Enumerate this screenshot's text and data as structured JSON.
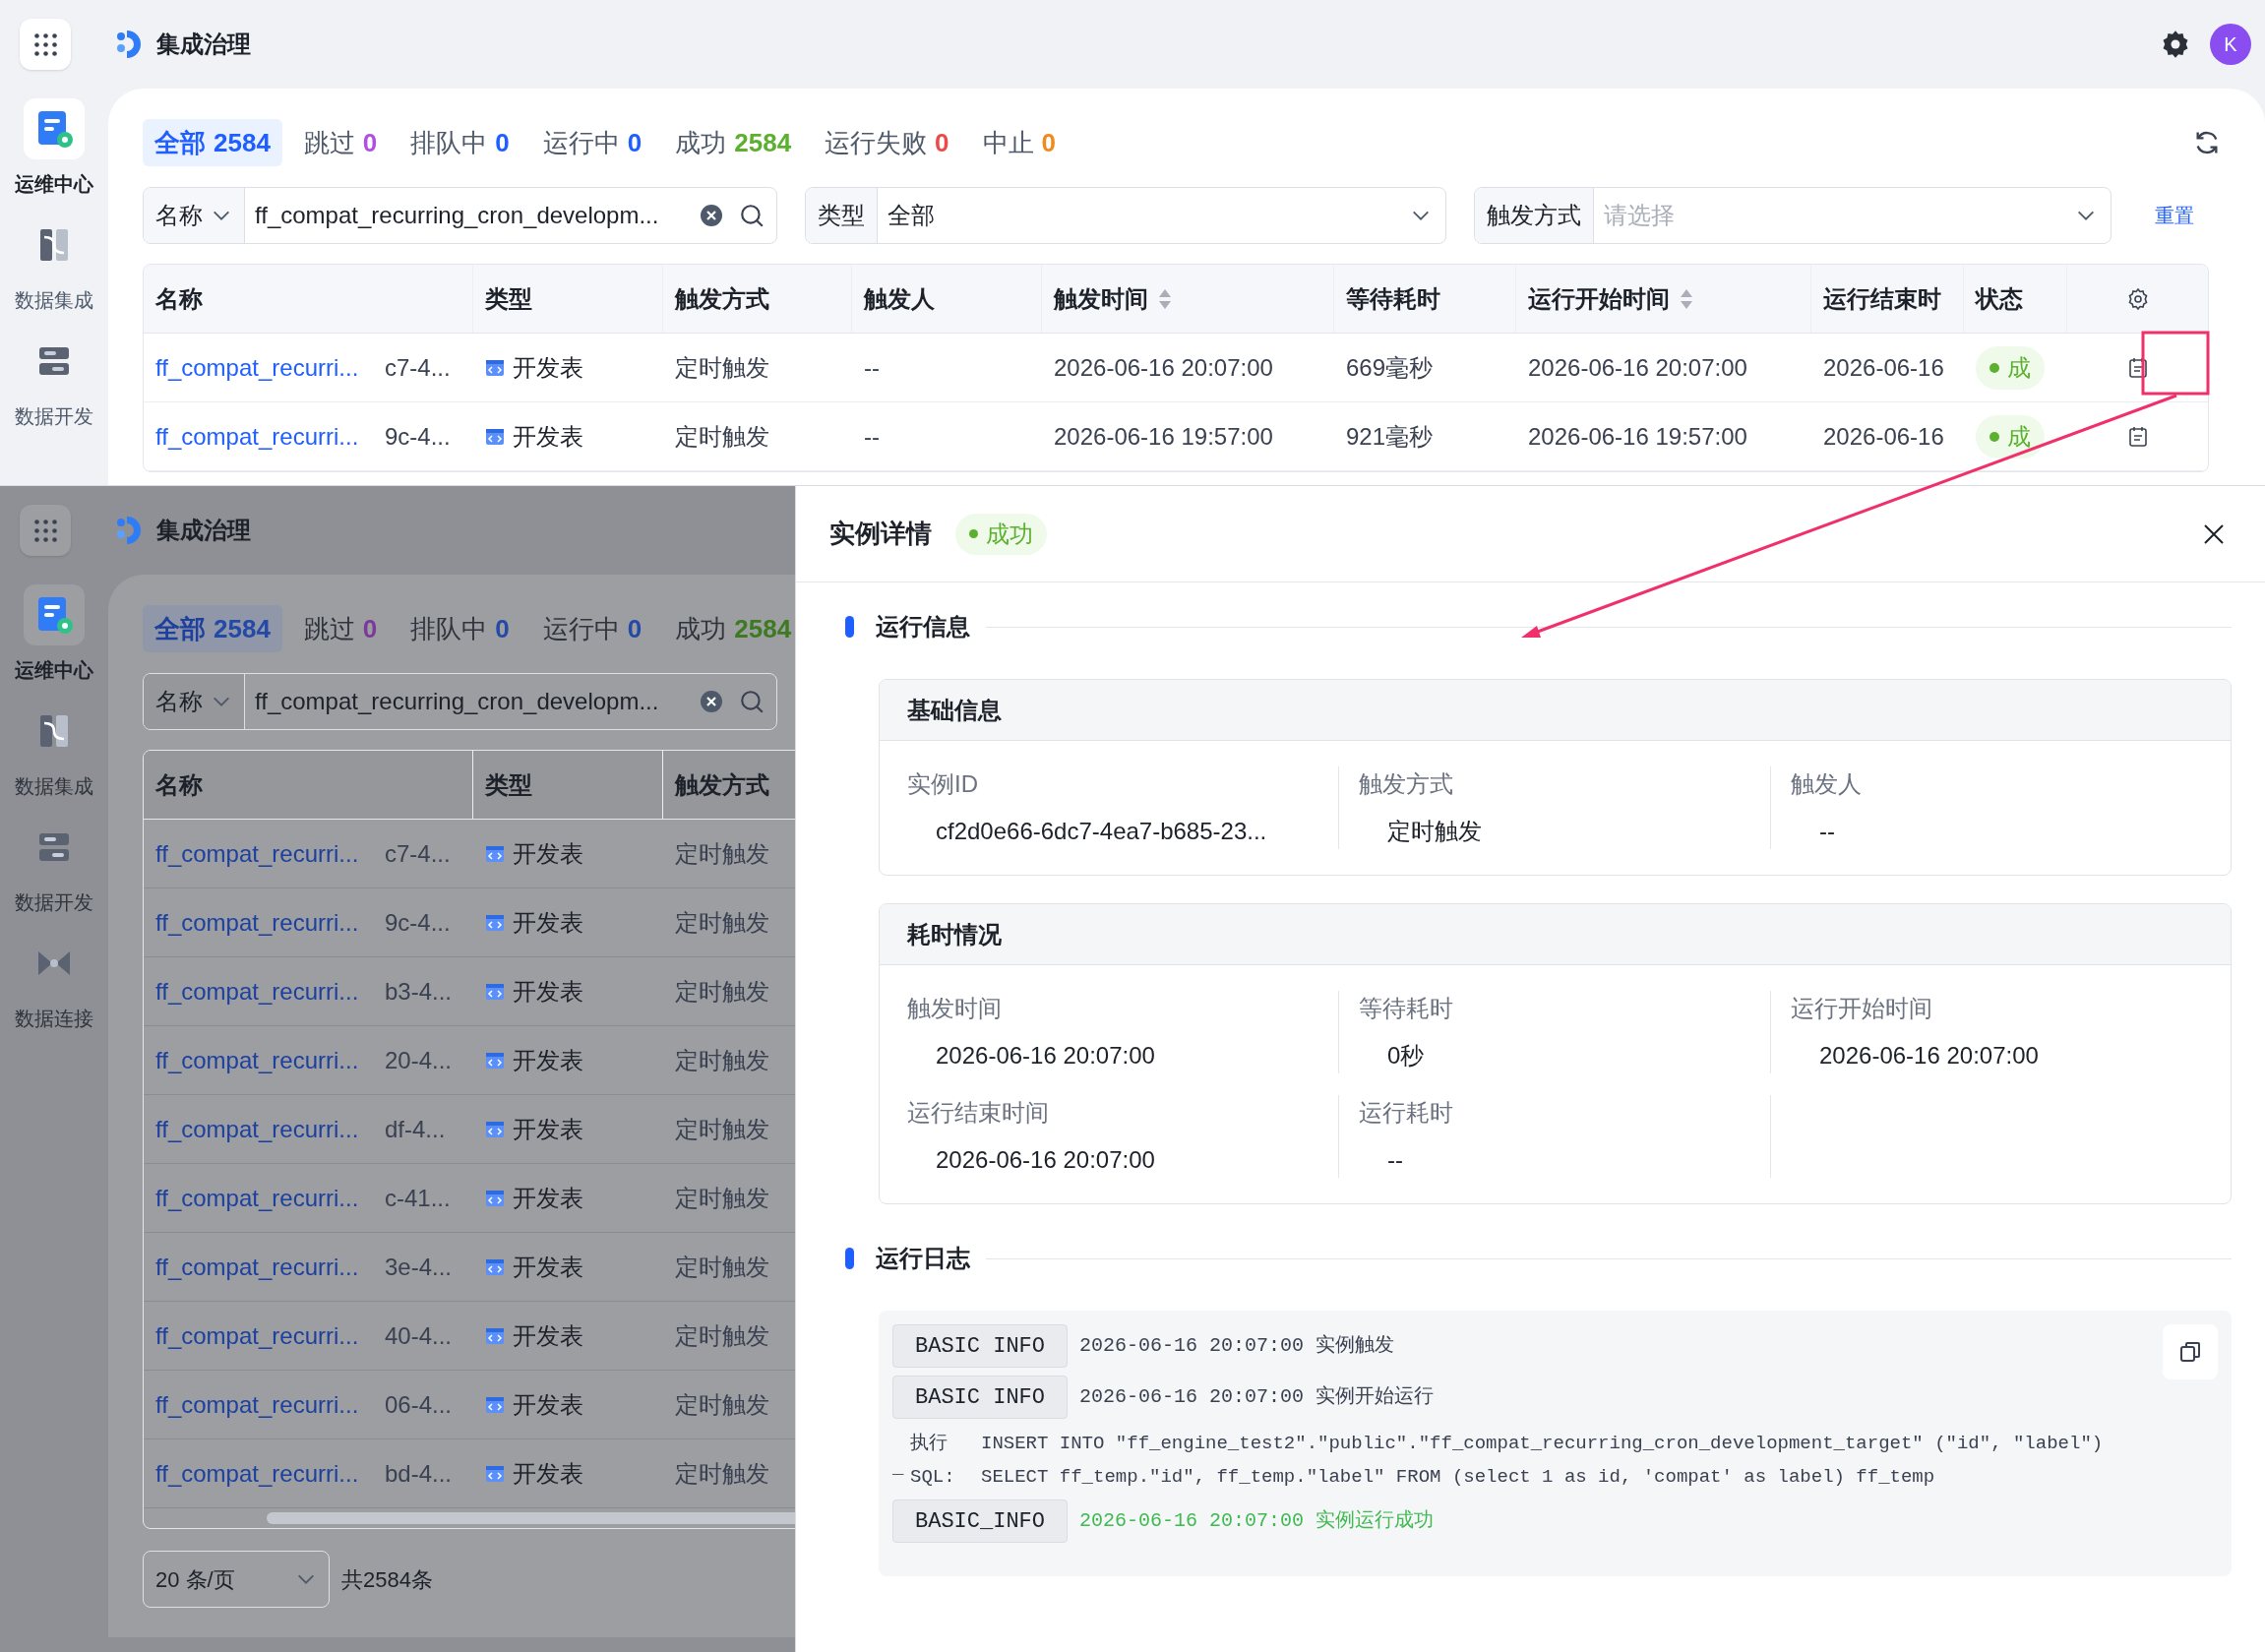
{
  "top_view": {
    "header": {
      "title": "集成治理",
      "avatar": "K"
    },
    "sidebar": [
      {
        "label": "运维中心",
        "selected": true
      },
      {
        "label": "数据集成",
        "selected": false
      },
      {
        "label": "数据开发",
        "selected": false
      }
    ],
    "status_tabs": [
      {
        "label": "全部",
        "count": "2584",
        "color": "#1f5eff",
        "selected": true
      },
      {
        "label": "跳过",
        "count": "0",
        "color": "#b04fe0",
        "selected": false
      },
      {
        "label": "排队中",
        "count": "0",
        "color": "#1f5eff",
        "selected": false
      },
      {
        "label": "运行中",
        "count": "0",
        "color": "#1f5eff",
        "selected": false
      },
      {
        "label": "成功",
        "count": "2584",
        "color": "#5cb030",
        "selected": false
      },
      {
        "label": "运行失败",
        "count": "0",
        "color": "#f04848",
        "selected": false
      },
      {
        "label": "中止",
        "count": "0",
        "color": "#f08a1c",
        "selected": false
      }
    ],
    "filters": [
      {
        "kind": "search",
        "label": "名称",
        "value": "ff_compat_recurring_cron_developm..."
      },
      {
        "kind": "select",
        "label": "类型",
        "value": "全部"
      },
      {
        "kind": "select",
        "label": "触发方式",
        "placeholder": "请选择"
      }
    ],
    "reset_link": "重置",
    "table": {
      "columns": [
        {
          "label": "名称"
        },
        {
          "label": "类型"
        },
        {
          "label": "触发方式"
        },
        {
          "label": "触发人"
        },
        {
          "label": "触发时间",
          "sortable": true
        },
        {
          "label": "等待耗时"
        },
        {
          "label": "运行开始时间",
          "sortable": true
        },
        {
          "label": "运行结束时"
        },
        {
          "label": "状态"
        }
      ],
      "rows": [
        {
          "cells": [
            {
              "name": "ff_compat_recurri...",
              "tail": "c7-4..."
            },
            "开发表",
            "定时触发",
            "--",
            "2026-06-16 20:07:00",
            "669毫秒",
            "2026-06-16 20:07:00",
            "2026-06-16",
            "成"
          ]
        },
        {
          "cells": [
            {
              "name": "ff_compat_recurri...",
              "tail": "9c-4..."
            },
            "开发表",
            "定时触发",
            "--",
            "2026-06-16 19:57:00",
            "921毫秒",
            "2026-06-16 19:57:00",
            "2026-06-16",
            "成"
          ]
        }
      ]
    }
  },
  "bottom_view": {
    "background_app": {
      "header": {
        "title": "集成治理"
      },
      "sidebar": [
        {
          "label": "运维中心",
          "selected": true
        },
        {
          "label": "数据集成",
          "selected": false
        },
        {
          "label": "数据开发",
          "selected": false
        },
        {
          "label": "数据连接",
          "selected": false
        }
      ],
      "status_tabs": [
        {
          "label": "全部",
          "count": "2584",
          "color": "#2449a6",
          "selected": true
        },
        {
          "label": "跳过",
          "count": "0",
          "color": "#7a3a9a",
          "selected": false
        },
        {
          "label": "排队中",
          "count": "0",
          "color": "#2449a6",
          "selected": false
        },
        {
          "label": "运行中",
          "count": "0",
          "color": "#2449a6",
          "selected": false
        },
        {
          "label": "成功",
          "count": "2584",
          "color": "#3e7a22",
          "selected": false
        }
      ],
      "filters": [
        {
          "kind": "search",
          "label": "名称",
          "value": "ff_compat_recurring_cron_developm..."
        }
      ],
      "table": {
        "columns": [
          {
            "label": "名称"
          },
          {
            "label": "类型"
          },
          {
            "label": "触发方式"
          }
        ],
        "rows": [
          {
            "cells": [
              {
                "name": "ff_compat_recurri...",
                "tail": "c7-4..."
              },
              "开发表",
              "定时触发"
            ]
          },
          {
            "cells": [
              {
                "name": "ff_compat_recurri...",
                "tail": "9c-4..."
              },
              "开发表",
              "定时触发"
            ]
          },
          {
            "cells": [
              {
                "name": "ff_compat_recurri...",
                "tail": "b3-4..."
              },
              "开发表",
              "定时触发"
            ]
          },
          {
            "cells": [
              {
                "name": "ff_compat_recurri...",
                "tail": "20-4..."
              },
              "开发表",
              "定时触发"
            ]
          },
          {
            "cells": [
              {
                "name": "ff_compat_recurri...",
                "tail": "df-4..."
              },
              "开发表",
              "定时触发"
            ]
          },
          {
            "cells": [
              {
                "name": "ff_compat_recurri...",
                "tail": "c-41..."
              },
              "开发表",
              "定时触发"
            ]
          },
          {
            "cells": [
              {
                "name": "ff_compat_recurri...",
                "tail": "3e-4..."
              },
              "开发表",
              "定时触发"
            ]
          },
          {
            "cells": [
              {
                "name": "ff_compat_recurri...",
                "tail": "40-4..."
              },
              "开发表",
              "定时触发"
            ]
          },
          {
            "cells": [
              {
                "name": "ff_compat_recurri...",
                "tail": "06-4..."
              },
              "开发表",
              "定时触发"
            ]
          },
          {
            "cells": [
              {
                "name": "ff_compat_recurri...",
                "tail": "bd-4..."
              },
              "开发表",
              "定时触发"
            ]
          }
        ]
      },
      "pagination": {
        "page_size": "20 条/页",
        "total": "共2584条"
      }
    },
    "drawer": {
      "title": "实例详情",
      "status": "成功",
      "sections": [
        {
          "title": "运行信息",
          "cards": [
            {
              "title": "基础信息",
              "fields": [
                {
                  "label": "实例ID",
                  "value": "cf2d0e66-6dc7-4ea7-b685-23..."
                },
                {
                  "label": "触发方式",
                  "value": "定时触发"
                },
                {
                  "label": "触发人",
                  "value": "--"
                }
              ]
            },
            {
              "title": "耗时情况",
              "fields": [
                {
                  "label": "触发时间",
                  "value": "2026-06-16 20:07:00"
                },
                {
                  "label": "等待耗时",
                  "value": "0秒"
                },
                {
                  "label": "运行开始时间",
                  "value": "2026-06-16 20:07:00"
                },
                {
                  "label": "运行结束时间",
                  "value": "2026-06-16 20:07:00"
                },
                {
                  "label": "运行耗时",
                  "value": "--"
                }
              ]
            }
          ]
        },
        {
          "title": "运行日志",
          "log": [
            {
              "kind": "tagged",
              "tag": "BASIC INFO",
              "time": "2026-06-16 20:07:00",
              "message": "实例触发",
              "success": false
            },
            {
              "kind": "tagged",
              "tag": "BASIC INFO",
              "time": "2026-06-16 20:07:00",
              "message": "实例开始运行",
              "success": false
            },
            {
              "kind": "sql",
              "marker": "_",
              "label": "执行 SQL:",
              "text": "INSERT INTO \"ff_engine_test2\".\"public\".\"ff_compat_recurring_cron_development_target\" (\"id\", \"label\") SELECT ff_temp.\"id\", ff_temp.\"label\" FROM (select 1 as id, 'compat' as label) ff_temp"
            },
            {
              "kind": "tagged",
              "tag": "BASIC_INFO",
              "time": "2026-06-16 20:07:00",
              "message": "实例运行成功",
              "success": true
            }
          ]
        }
      ]
    }
  }
}
